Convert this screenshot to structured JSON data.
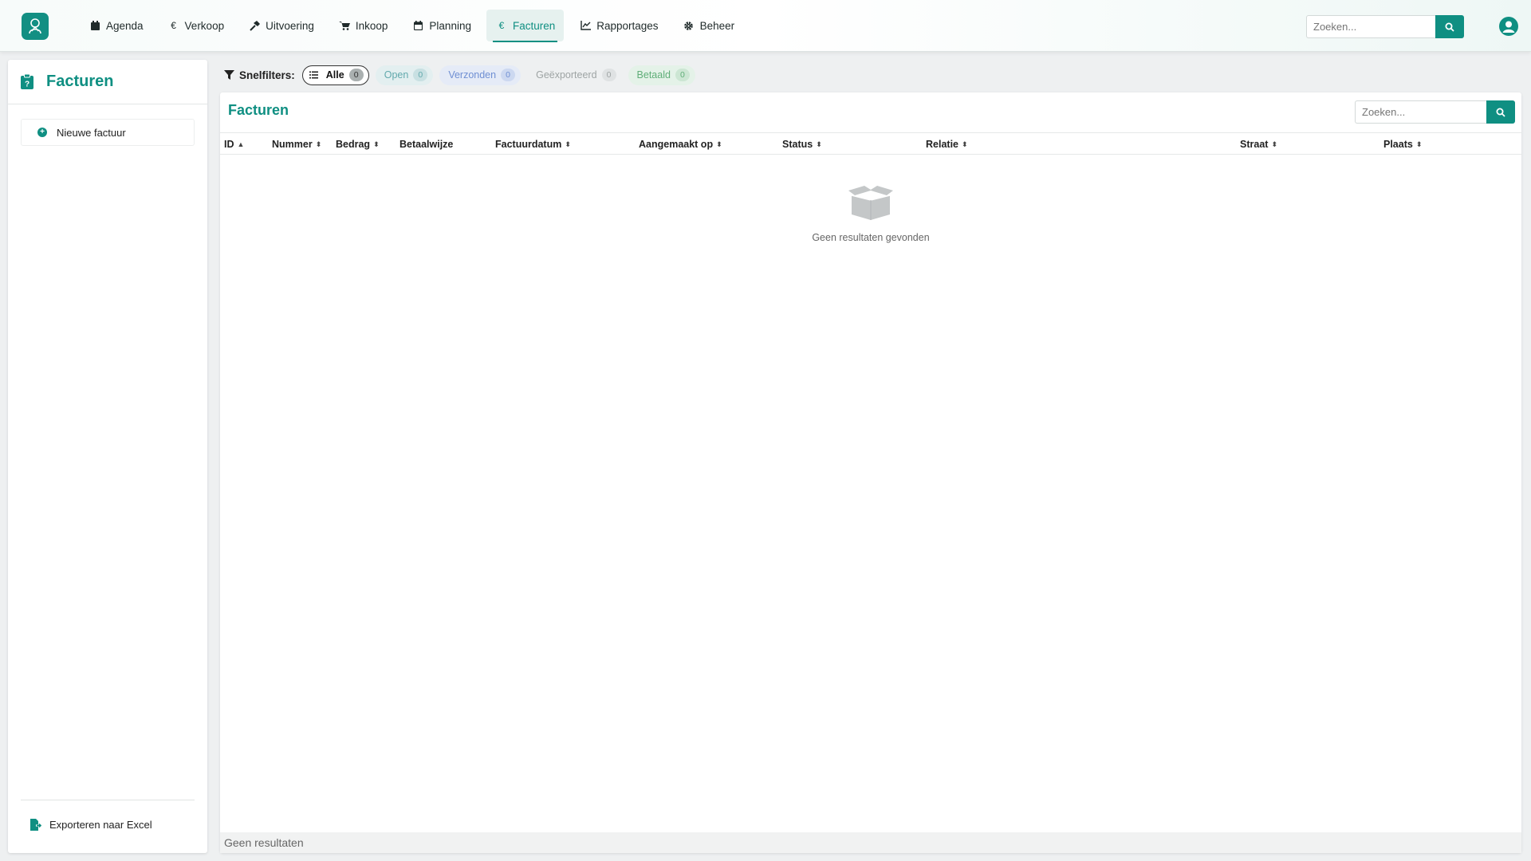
{
  "nav": {
    "items": [
      {
        "label": "Agenda",
        "icon": "calendar-icon"
      },
      {
        "label": "Verkoop",
        "icon": "euro-icon"
      },
      {
        "label": "Uitvoering",
        "icon": "hammer-icon"
      },
      {
        "label": "Inkoop",
        "icon": "cart-icon"
      },
      {
        "label": "Planning",
        "icon": "calendar-grid-icon"
      },
      {
        "label": "Facturen",
        "icon": "euro-icon",
        "active": true
      },
      {
        "label": "Rapportages",
        "icon": "line-chart-icon"
      },
      {
        "label": "Beheer",
        "icon": "gear-icon"
      }
    ]
  },
  "header": {
    "search": {
      "placeholder": "Zoeken..."
    }
  },
  "sidebar": {
    "title": "Facturen",
    "new_invoice": "Nieuwe factuur",
    "export": "Exporteren naar Excel"
  },
  "filters": {
    "label": "Snelfilters:",
    "chips": [
      {
        "label": "Alle",
        "count": "0"
      },
      {
        "label": "Open",
        "count": "0"
      },
      {
        "label": "Verzonden",
        "count": "0"
      },
      {
        "label": "Geëxporteerd",
        "count": "0"
      },
      {
        "label": "Betaald",
        "count": "0"
      }
    ]
  },
  "panel": {
    "title": "Facturen",
    "search": {
      "placeholder": "Zoeken..."
    },
    "columns": [
      "ID",
      "Nummer",
      "Bedrag",
      "Betaalwijze",
      "Factuurdatum",
      "Aangemaakt op",
      "Status",
      "Relatie",
      "Straat",
      "Plaats"
    ],
    "empty_text": "Geen resultaten gevonden",
    "footer": "Geen resultaten"
  },
  "colors": {
    "accent": "#0f8f82"
  }
}
